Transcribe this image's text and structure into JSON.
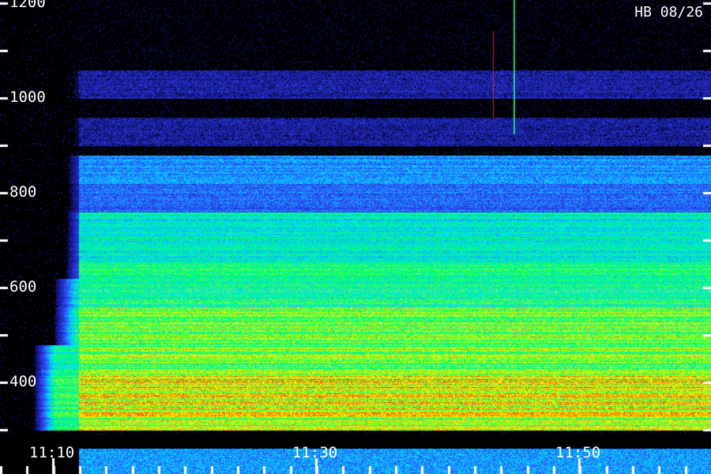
{
  "chart_data": {
    "type": "heatmap",
    "title": "HB 08/26",
    "xlabel": "",
    "ylabel": "",
    "y_ticks": [
      {
        "value": 1200,
        "label": "1200"
      },
      {
        "value": 1000,
        "label": "1000"
      },
      {
        "value": 800,
        "label": "800"
      },
      {
        "value": 600,
        "label": "600"
      },
      {
        "value": 400,
        "label": "400"
      }
    ],
    "y_minor_ticks": [
      1100,
      900,
      700,
      500,
      300
    ],
    "ylim": [
      300,
      1200
    ],
    "x_ticks": [
      {
        "value": "11:10",
        "label": "11:10"
      },
      {
        "value": "11:30",
        "label": "11:30"
      },
      {
        "value": "11:50",
        "label": "11:50"
      }
    ],
    "xlim": [
      "11:06",
      "12:00"
    ],
    "x_minor_tick_step_minutes": 2,
    "grid": false,
    "colorscale": [
      "#000000",
      "#1a1aa0",
      "#3050ff",
      "#00e0ff",
      "#00ff60",
      "#ffff00",
      "#ff2000"
    ],
    "onset_time": "11:12",
    "bands": [
      {
        "from": 1000,
        "to": 1060,
        "level": 0.18
      },
      {
        "from": 900,
        "to": 960,
        "level": 0.18
      },
      {
        "from": 820,
        "to": 880,
        "level": 0.4
      },
      {
        "from": 760,
        "to": 820,
        "level": 0.35
      },
      {
        "from": 650,
        "to": 760,
        "level": 0.55
      },
      {
        "from": 560,
        "to": 650,
        "level": 0.62
      },
      {
        "from": 420,
        "to": 560,
        "level": 0.72
      },
      {
        "from": 330,
        "to": 420,
        "level": 0.82
      },
      {
        "from": 300,
        "to": 330,
        "level": 0.75
      }
    ]
  }
}
